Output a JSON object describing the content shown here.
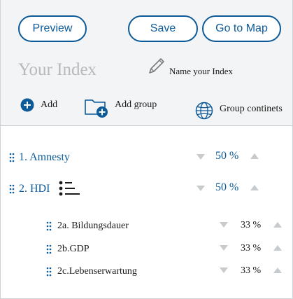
{
  "toolbar": {
    "preview_label": "Preview",
    "save_label": "Save",
    "map_label": "Go to Map"
  },
  "index": {
    "title_placeholder": "Your Index",
    "name_label": "Name your Index"
  },
  "tools": {
    "add_label": "Add",
    "add_group_label": "Add group",
    "group_continents_label": "Group continets"
  },
  "items": [
    {
      "label": "1. Amnesty",
      "percent": "50 %"
    },
    {
      "label": "2. HDI",
      "percent": "50 %",
      "children": [
        {
          "label": "2a. Bildungsdauer",
          "percent": "33 %"
        },
        {
          "label": "2b.GDP",
          "percent": "33 %"
        },
        {
          "label": "2c.Lebenserwartung",
          "percent": "33 %"
        }
      ]
    }
  ],
  "colors": {
    "accent": "#0d5a99",
    "arrow": "#c8cbce",
    "panel": "#f3f4f5"
  },
  "icons": [
    "pencil-icon",
    "plus-circle-icon",
    "folder-plus-icon",
    "globe-icon",
    "drag-handle-icon",
    "list-icon",
    "arrow-up-icon",
    "arrow-down-icon"
  ]
}
